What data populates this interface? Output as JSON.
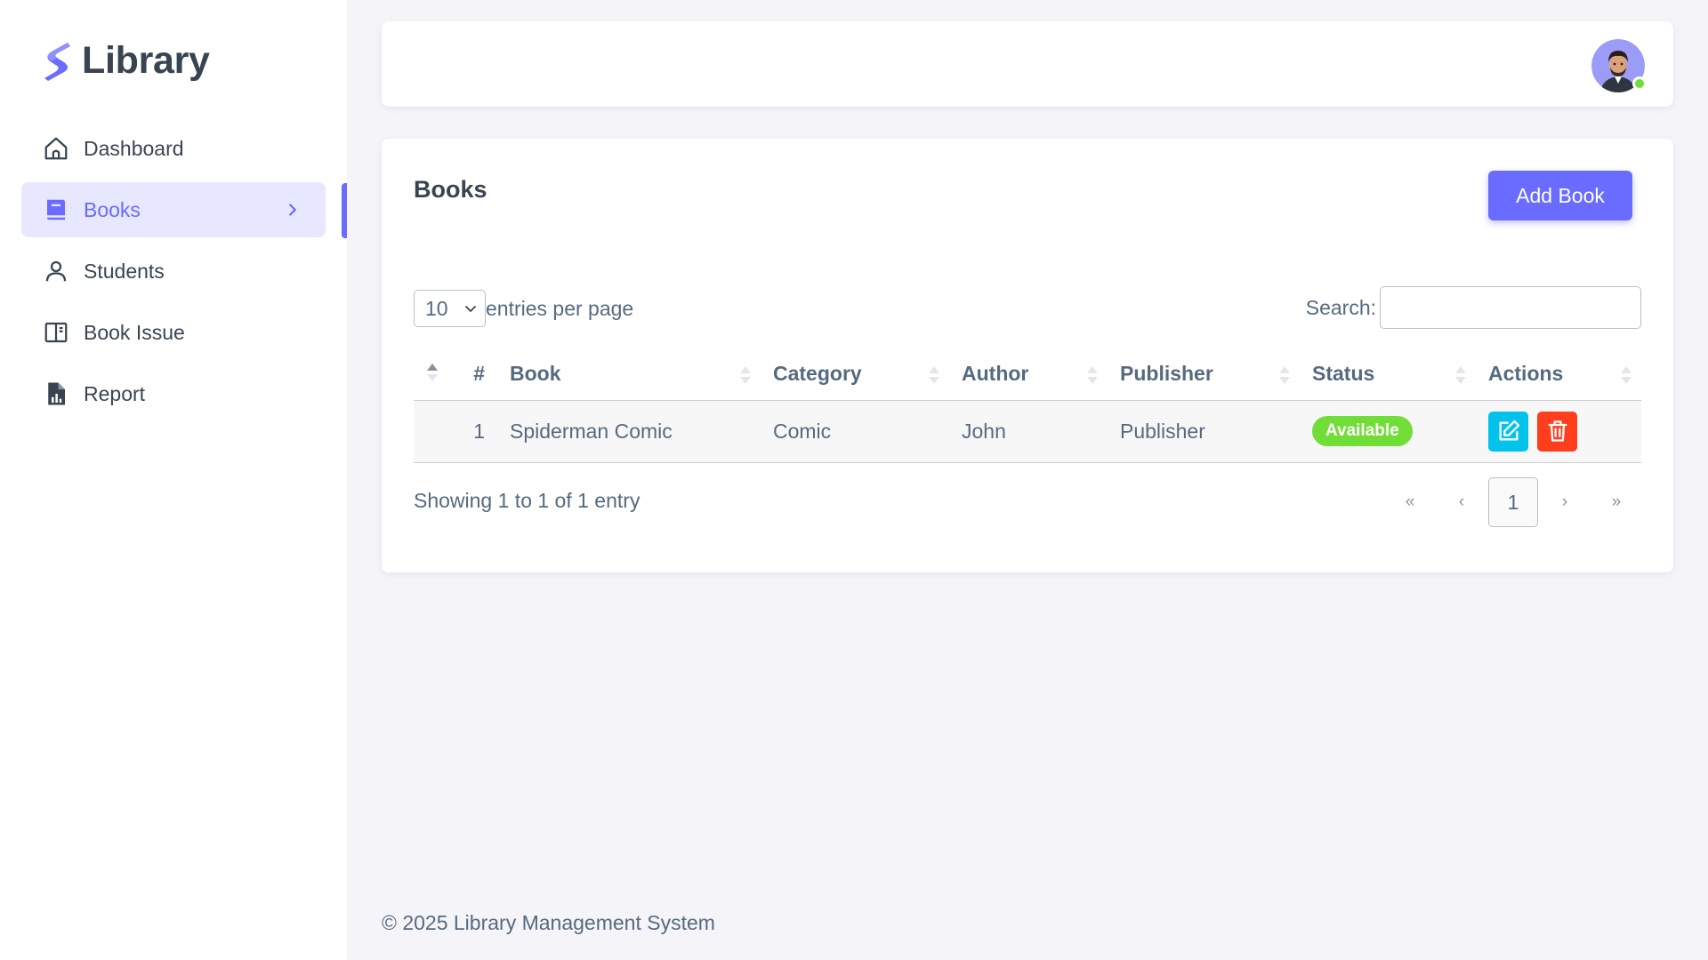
{
  "brand": {
    "name": "Library",
    "color": "#696cff"
  },
  "sidebar": {
    "items": [
      {
        "label": "Dashboard",
        "icon": "home-icon",
        "active": false
      },
      {
        "label": "Books",
        "icon": "book-icon",
        "active": true
      },
      {
        "label": "Students",
        "icon": "user-icon",
        "active": false
      },
      {
        "label": "Book Issue",
        "icon": "book-open-icon",
        "active": false
      },
      {
        "label": "Report",
        "icon": "report-file-icon",
        "active": false
      }
    ]
  },
  "navbar": {
    "avatar_status": "online",
    "status_color": "#71dd37"
  },
  "card": {
    "title": "Books",
    "add_button": "Add Book",
    "entries": {
      "value": "10",
      "label": "entries per page"
    },
    "search": {
      "label": "Search:",
      "value": "",
      "placeholder": ""
    },
    "table": {
      "columns": [
        "#",
        "Book",
        "Category",
        "Author",
        "Publisher",
        "Status",
        "Actions"
      ],
      "rows": [
        {
          "num": "1",
          "book": "Spiderman Comic",
          "category": "Comic",
          "author": "John",
          "publisher": "Publisher",
          "status": "Available"
        }
      ]
    },
    "info": "Showing 1 to 1 of 1 entry",
    "pagination": {
      "first": "«",
      "prev": "‹",
      "current": "1",
      "next": "›",
      "last": "»"
    }
  },
  "colors": {
    "primary": "#696cff",
    "success": "#71dd37",
    "info": "#03c3ec",
    "danger": "#ff3e1d"
  },
  "footer": {
    "text": "© 2025 Library Management System"
  }
}
